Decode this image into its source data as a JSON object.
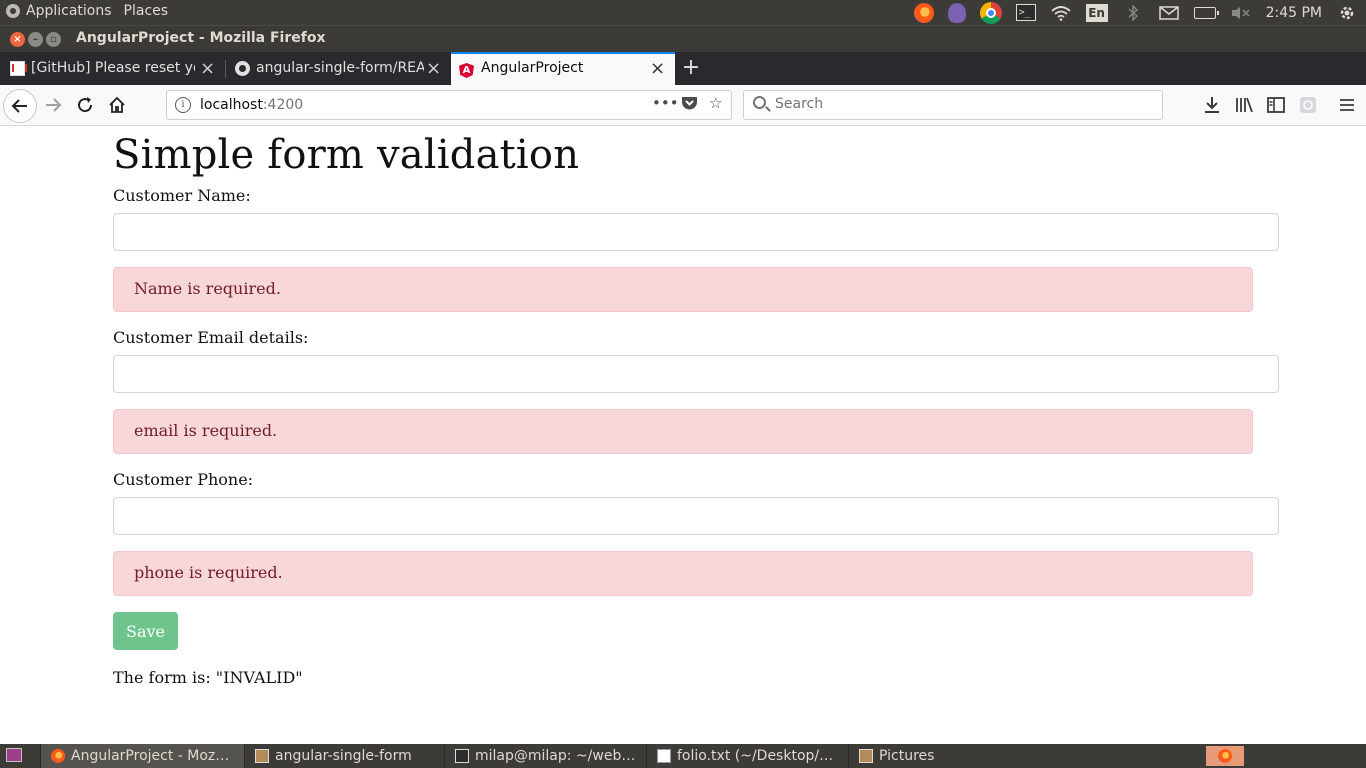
{
  "top_panel": {
    "applications_label": "Applications",
    "places_label": "Places",
    "keyboard_layout": "En",
    "clock": "2:45 PM"
  },
  "window": {
    "title": "AngularProject - Mozilla Firefox"
  },
  "tabs": [
    {
      "title": "[GitHub] Please reset yo",
      "favicon": "gmail-icon"
    },
    {
      "title": "angular-single-form/REA",
      "favicon": "github-icon"
    },
    {
      "title": "AngularProject",
      "favicon": "angular-icon",
      "active": true
    }
  ],
  "toolbar": {
    "url_host": "localhost",
    "url_port": ":4200",
    "search_placeholder": "Search"
  },
  "page": {
    "title": "Simple form validation",
    "fields": [
      {
        "label": "Customer Name:",
        "value": "",
        "error": "Name is required."
      },
      {
        "label": "Customer Email details:",
        "value": "",
        "error": "email is required."
      },
      {
        "label": "Customer Phone:",
        "value": "",
        "error": "phone is required."
      }
    ],
    "save_label": "Save",
    "form_status": "The form is: \"INVALID\"",
    "colors": {
      "alert_bg": "#f8d7da",
      "alert_text": "#721c24",
      "save_button": "#6ec48a"
    }
  },
  "taskbar": {
    "items": [
      {
        "label": "AngularProject - Moz…",
        "icon": "firefox-icon",
        "active": true
      },
      {
        "label": "angular-single-form",
        "icon": "folder-icon"
      },
      {
        "label": "milap@milap: ~/web…",
        "icon": "terminal-icon"
      },
      {
        "label": "folio.txt (~/Desktop/…",
        "icon": "text-editor-icon"
      },
      {
        "label": "Pictures",
        "icon": "folder-icon"
      }
    ]
  }
}
